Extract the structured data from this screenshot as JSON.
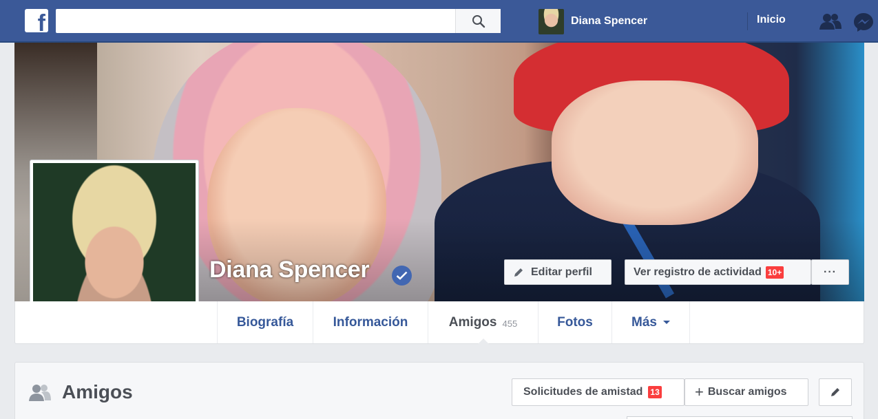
{
  "topbar": {
    "logo_letter": "f",
    "search_placeholder": "",
    "user_name": "Diana Spencer",
    "home_label": "Inicio",
    "icons": [
      "facebook-logo-icon",
      "search-icon",
      "friend-requests-icon",
      "messenger-icon"
    ]
  },
  "profile": {
    "name": "Diana Spencer",
    "verified": true,
    "edit_label": "Editar perfil",
    "activity_label": "Ver registro de actividad",
    "activity_badge": "10+",
    "more_label": "···"
  },
  "nav": {
    "tabs": [
      {
        "label": "Biografía"
      },
      {
        "label": "Información"
      },
      {
        "label": "Amigos",
        "count": "455"
      },
      {
        "label": "Fotos"
      },
      {
        "label": "Más"
      }
    ],
    "active_tab": "Amigos"
  },
  "friends_section": {
    "title": "Amigos",
    "requests_label": "Solicitudes de amistad",
    "requests_count": "13",
    "find_label": "Buscar amigos",
    "find_prefix": "+"
  },
  "colors": {
    "brand": "#3b5998",
    "link": "#365899",
    "badge": "#fa3e3e"
  }
}
